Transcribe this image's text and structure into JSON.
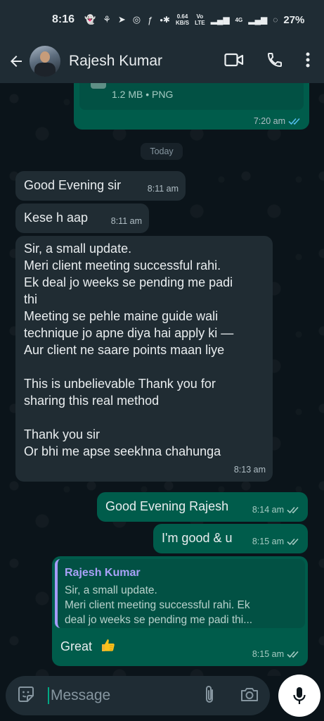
{
  "status_bar": {
    "time": "8:16",
    "net_speed": "0.64",
    "net_unit": "KB/S",
    "volte": "Vo LTE",
    "lte": "4G",
    "battery": "27%"
  },
  "header": {
    "contact_name": "Rajesh Kumar"
  },
  "file_message": {
    "meta": "1.2 MB • PNG",
    "time": "7:20 am"
  },
  "date_chip": "Today",
  "messages": [
    {
      "text": "Good Evening sir",
      "time": "8:11 am"
    },
    {
      "text": "Kese h aap",
      "time": "8:11 am"
    },
    {
      "lines": [
        "Sir, a small update.",
        "Meri client meeting successful rahi.",
        "Ek deal jo weeks se pending me padi",
        "thi",
        "Meeting se pehle maine guide wali",
        "technique jo apne diya hai apply ki —",
        "Aur client ne saare points maan liye",
        "",
        "This is unbelievable Thank you for",
        "sharing this real method",
        "",
        "Thank you sir",
        "Or bhi me apse seekhna chahunga"
      ],
      "time": "8:13 am"
    },
    {
      "text": "Good Evening Rajesh",
      "time": "8:14 am"
    },
    {
      "text": "I'm good & u",
      "time": "8:15 am"
    },
    {
      "quote_name": "Rajesh Kumar",
      "quote_lines": [
        "Sir, a small update.",
        "Meri client meeting successful rahi. Ek",
        "deal jo weeks se pending me padi thi..."
      ],
      "text": "Great",
      "time": "8:15 am"
    }
  ],
  "input": {
    "placeholder": "Message"
  },
  "colors": {
    "incoming_bubble": "#202c33",
    "outgoing_bubble": "#005c4b",
    "read_ticks": "#53bdeb",
    "quote_accent": "#a79bf9"
  },
  "icons": [
    "back-arrow-icon",
    "video-call-icon",
    "phone-icon",
    "more-vert-icon",
    "sticker-icon",
    "attach-icon",
    "camera-icon",
    "mic-icon",
    "thumbs-up-emoji"
  ]
}
